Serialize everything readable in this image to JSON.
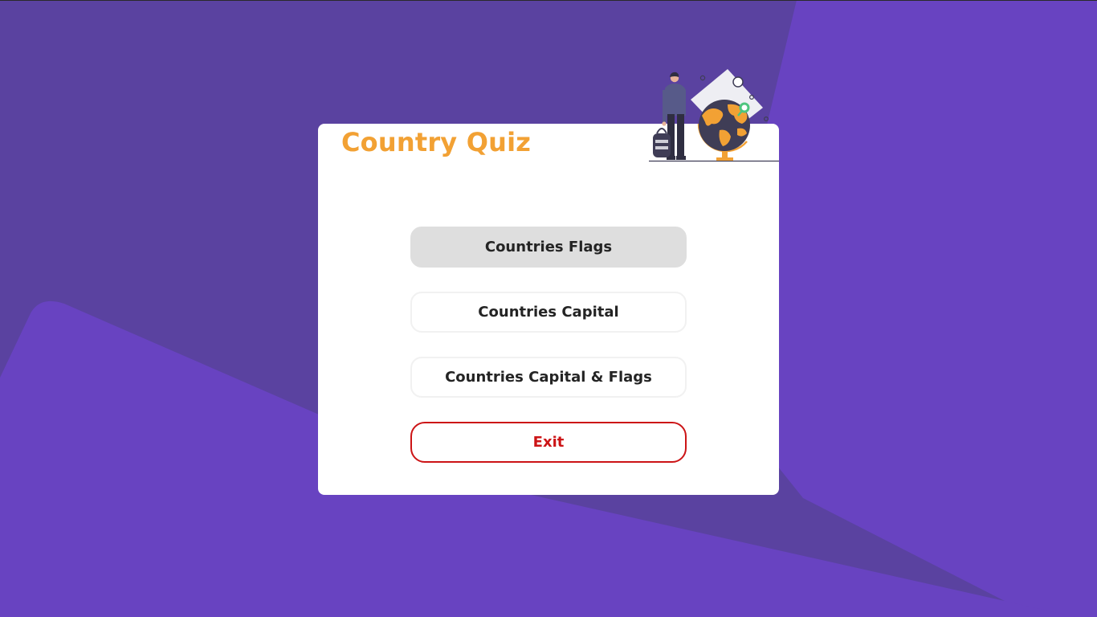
{
  "app": {
    "title": "Country Quiz"
  },
  "menu": {
    "options": [
      {
        "label": "Countries Flags",
        "state": "highlighted"
      },
      {
        "label": "Countries Capital",
        "state": "default"
      },
      {
        "label": "Countries Capital & Flags",
        "state": "default"
      }
    ],
    "exit_label": "Exit"
  },
  "illustration": {
    "icon": "traveler-with-globe-illustration"
  },
  "colors": {
    "background": "#5a42a0",
    "background_light": "#6843c1",
    "card": "#ffffff",
    "title": "#f2a134",
    "button_highlight": "#dedede",
    "button_text": "#242424",
    "exit": "#cc1416",
    "globe_land": "#f2a134",
    "globe_ocean": "#3f3d56"
  }
}
